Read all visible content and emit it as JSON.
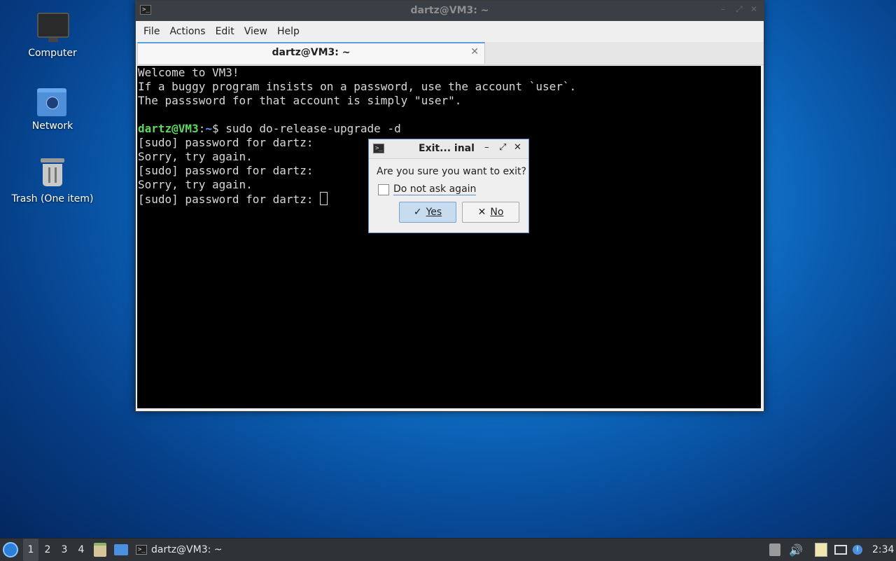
{
  "desktop": {
    "icons": [
      {
        "label": "Computer",
        "icon": "computer-icon"
      },
      {
        "label": "Network",
        "icon": "network-folder-icon"
      },
      {
        "label": "Trash (One item)",
        "icon": "trash-icon"
      }
    ]
  },
  "terminal_window": {
    "title": "dartz@VM3: ~",
    "menu": [
      "File",
      "Actions",
      "Edit",
      "View",
      "Help"
    ],
    "tab_label": "dartz@VM3: ~",
    "lines": [
      "Welcome to VM3!",
      "If a buggy program insists on a password, use the account `user`.",
      "The passsword for that account is simply \"user\".",
      "",
      "",
      "[sudo] password for dartz:",
      "Sorry, try again.",
      "[sudo] password for dartz:",
      "Sorry, try again.",
      "[sudo] password for dartz: "
    ],
    "prompt": {
      "user_host": "dartz@VM3",
      "sep": ":",
      "path": "~",
      "symbol": "$",
      "command": " sudo do-release-upgrade -d"
    }
  },
  "dialog": {
    "title": "Exit... inal",
    "question": "Are you sure you want to exit?",
    "checkbox_label": "Do not ask again",
    "checkbox_checked": false,
    "yes_label": "Yes",
    "no_label": "No"
  },
  "taskbar": {
    "workspaces": [
      "1",
      "2",
      "3",
      "4"
    ],
    "active_workspace": "1",
    "window_button_label": "dartz@VM3: ~",
    "clock": "2:34"
  },
  "colors": {
    "prompt_user": "#5fd75f",
    "prompt_path": "#5c9cff",
    "dialog_accent": "#5a8fc8"
  }
}
